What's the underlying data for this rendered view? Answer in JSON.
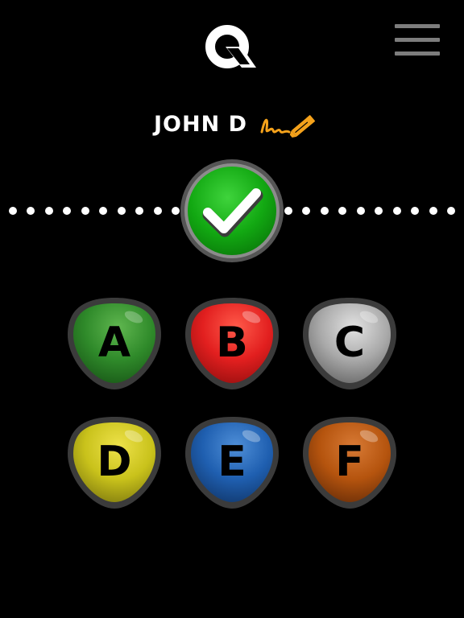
{
  "header": {
    "logo_letter": "Q",
    "logo_icon": "quiz-q-logo",
    "menu_icon": "hamburger-menu-icon"
  },
  "player": {
    "name": "JOHN D",
    "edit_icon": "signature-pencil-icon",
    "edit_color": "#f5a21b"
  },
  "progress": {
    "status_icon": "checkmark-icon",
    "status": "correct",
    "status_color": "#16b01a"
  },
  "answers": [
    {
      "letter": "A",
      "color": "#2f8a2a"
    },
    {
      "letter": "B",
      "color": "#e21f1f"
    },
    {
      "letter": "C",
      "color": "#a9a9a9"
    },
    {
      "letter": "D",
      "color": "#c9c21b"
    },
    {
      "letter": "E",
      "color": "#1f5fb0"
    },
    {
      "letter": "F",
      "color": "#b5540e"
    }
  ]
}
